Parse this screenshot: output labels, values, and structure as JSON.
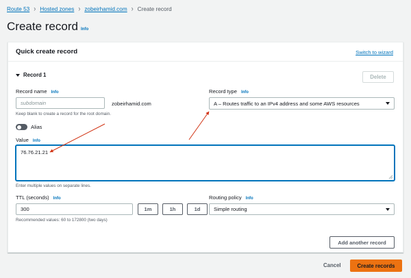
{
  "breadcrumb": {
    "items": [
      "Route 53",
      "Hosted zones",
      "zobeirhamid.com"
    ],
    "current": "Create record"
  },
  "page": {
    "title": "Create record",
    "info": "Info"
  },
  "panel": {
    "title": "Quick create record",
    "switch_label": "Switch to wizard",
    "record_label": "Record 1",
    "delete_label": "Delete"
  },
  "record_name": {
    "label": "Record name",
    "info": "Info",
    "placeholder": "subdomain",
    "domain": "zobeirhamid.com",
    "hint": "Keep blank to create a record for the root domain."
  },
  "record_type": {
    "label": "Record type",
    "info": "Info",
    "selected": "A – Routes traffic to an IPv4 address and some AWS resources"
  },
  "alias": {
    "label": "Alias",
    "enabled": false
  },
  "value": {
    "label": "Value",
    "info": "Info",
    "text": "76.76.21.21",
    "hint": "Enter multiple values on separate lines."
  },
  "ttl": {
    "label": "TTL (seconds)",
    "info": "Info",
    "value": "300",
    "hint": "Recommended values: 60 to 172800 (two days)",
    "units": [
      "1m",
      "1h",
      "1d"
    ]
  },
  "routing": {
    "label": "Routing policy",
    "info": "Info",
    "selected": "Simple routing"
  },
  "actions": {
    "add_another": "Add another record",
    "cancel": "Cancel",
    "create": "Create records"
  },
  "colors": {
    "link": "#0073bb",
    "primary_button": "#ec7211",
    "annotation_arrow": "#d13212",
    "focus_border": "#0073bb"
  }
}
